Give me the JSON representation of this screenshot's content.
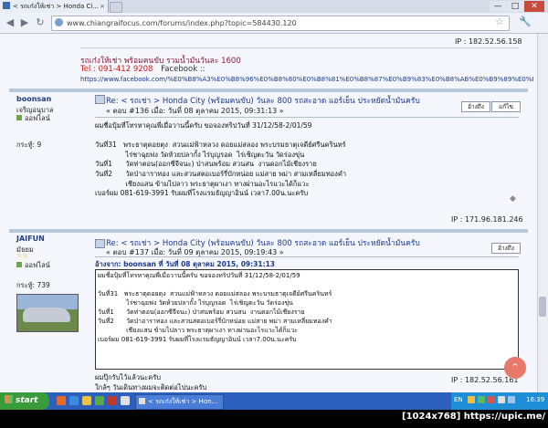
{
  "browser": {
    "tab_title": "< รถเก๋งให้เช่า > Honda Ci...",
    "tab_close": "×",
    "address": "www.chiangraifocus.com/forums/index.php?topic=584430.120",
    "window_min": "—",
    "window_max": "□",
    "window_close": "✕"
  },
  "page": {
    "top_ip": "IP : 182.52.56.158",
    "ad_line1": "รถเก๋งให้เช่า พร้อมคนขับ รวมน้ำมันวันละ 1600",
    "ad_line2_tel": "Tel : 091-412 9208",
    "ad_line2_fb": "Facebook  ::",
    "ad_url": "https://www.facebook.com/%E0%B8%A3%E0%B8%96%E0%B8%80%E0%B8%81%E0%B8%87%E0%B9%83%E0%B8%AB%E0%B9%89%E0%B9%80%E0%B8%8A%E0%B9%88%E0%B8%B2"
  },
  "post1": {
    "username": "boonsan",
    "rank": "เจริญอนุบาล",
    "status": "ออฟไลน์",
    "reputation": "กระทู้: 9",
    "title": "Re: < รถเช่า > Honda City (พร้อมคนขับ) วันละ 800 รถสะอาด แอร์เย็น ประหยัดน้ำมันครับ",
    "meta": "« ตอบ #136 เมื่อ: วันที่ 08 ตุลาคม 2015, 09:31:13 »",
    "quote_btn": "อ้างถึง",
    "edit_btn": "แก้ไข",
    "body": "ผมชื่อปุ้มที่โทรหาคุณพี่เมื่อวานนี้ครับ ขอจองทริปวันที่ 31/12/58-2/01/59\n\nวันที่31   พระธาตุดอยตุง  สวนแม่ฟ้าหลวง ดอยแม่สลอง พระบรมธาตุเจดีย์ศรีนครินทร์\n              ไร่ชาฉุยฟง วัดห้วยปลากั้ง ไร่บุญรอด  ไร่เชิญตะวัน วัดร่องขุ่น\nวันที่1      วัดท่าตอน(ออกซีจีจนะ) ป่าสนพร้อม สวนสน  งานดอกไม้เชียงราย\nวันที่2      วัดป่าอาราทอง และสวนสตอเบอร์รี่บักหน่อย แม่สาย พม่า สามเหลี่ยมทองคำ\n              เชียงแสน ข้ามไปลาว พระธาตุผาเงา ทางผ่านอะไรแวะได้ก็แวะ\nเบอร์ผม 081-619-3991 รับผมที่โรงแรมธัญญาอินน์ เวลา7.00น.นะครับ",
    "ip": "IP : 171.96.181.246"
  },
  "post2": {
    "username": "JAIFUN",
    "rank": "มัธยม",
    "stars": "☆☆",
    "status": "ออฟไลน์",
    "reputation": "กระทู้: 739",
    "title": "Re: < รถเช่า > Honda City (พร้อมคนขับ) วันละ 800 รถสะอาด แอร์เย็น ประหยัดน้ำมันครับ",
    "meta": "« ตอบ #137 เมื่อ: วันที่ 09 ตุลาคม 2015, 09:19:43 »",
    "quote_btn": "อ้างถึง",
    "quote_header": "อ้างจาก: boonsan ที่ วันที่ 08 ตุลาคม  2015, 09:31:13",
    "quote_body": "ผมชื่อปุ้มที่โทรหาคุณพี่เมื่อวานนี้ครับ ขอจองทริปวันที่ 31/12/58-2/01/59\n\nวันที่31   พระธาตุดอยตุง  สวนแม่ฟ้าหลวง ดอยแม่สลอง พระบรมธาตุเจดีย์ศรีนครินทร์\n              ไร่ชาฉุยฟง วัดห้วยปลากั้ง ไร่บุญรอด  ไร่เชิญตะวัน วัดร่องขุ่น\nวันที่1      วัดท่าตอน(ออกซีจีจนะ) ป่าสนพร้อม สวนสน  งานดอกไม้เชียงราย\nวันที่2      วัดป่าอาราทอง และสวนสตอเบอร์รี่บักหน่อย แม่สาย พม่า สามเหลี่ยมทองคำ\n              เชียงแสน ข้ามไปลาว พระธาตุผาเงา ทางผ่านอะไรแวะได้ก็แวะ\nเบอร์ผม 081-619-3991 รับผมที่โรงแรมธัญญาอินน์ เวลา7.00น.นะครับ",
    "reply": "ผมปุ๊กรับไว้แล้วนะครับ\nใกล้ๆ วันเดินทางผมจะติดต่อไปนะครับ",
    "ip": "IP : 182.52.56.161"
  },
  "taskbar": {
    "start": "start",
    "task1": "< รถเก๋งให้เช่า > Hon...",
    "lang": "EN",
    "clock": "16:39"
  },
  "overlay": {
    "banner": "[1024x768] https://upic.me/"
  },
  "colors": {
    "accent": "#2d5fbc",
    "link": "#1a3a8e",
    "ad_red": "#cc1a1a",
    "ad_maroon": "#8a1a38"
  }
}
